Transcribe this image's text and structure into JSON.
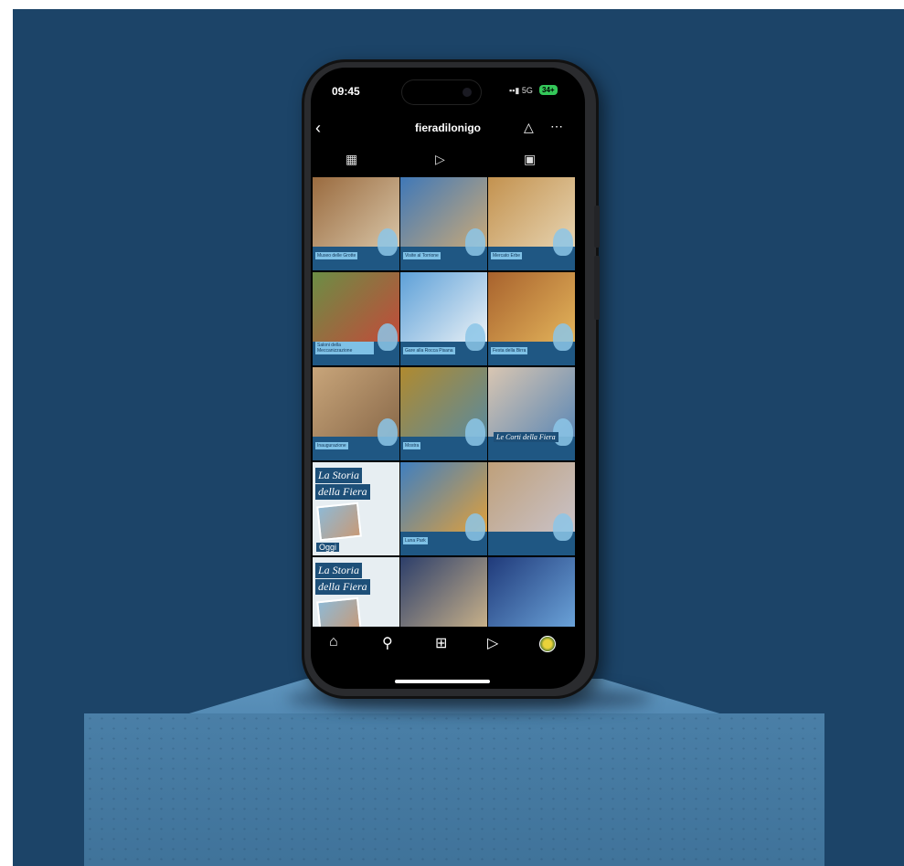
{
  "status": {
    "time": "09:45",
    "network": "5G",
    "battery": "34+"
  },
  "profile": {
    "username": "fieradilonigo"
  },
  "icons": {
    "back": "back-chevron-icon",
    "bell": "bell-icon",
    "more": "more-icon",
    "grid_tab": "grid-icon",
    "reels_tab": "reels-icon",
    "tagged_tab": "tagged-icon",
    "home": "home-icon",
    "search": "search-icon",
    "create": "create-icon",
    "reels": "reels-icon",
    "profile": "avatar"
  },
  "tiles": [
    {
      "label": "Museo delle Grotte",
      "colors": [
        "#9a6b3f",
        "#d7c4a6"
      ]
    },
    {
      "label": "Visite al Torrione",
      "colors": [
        "#3f78b8",
        "#c9a978"
      ]
    },
    {
      "label": "Mercato Erbe",
      "colors": [
        "#c3924f",
        "#e6d3b0"
      ]
    },
    {
      "label": "Saloni della Meccanizzazione",
      "colors": [
        "#6b8e45",
        "#c34a3a"
      ]
    },
    {
      "label": "Gare alla Rocca Pisana",
      "colors": [
        "#5da0d8",
        "#eaf1f6"
      ]
    },
    {
      "label": "Festa della Birra",
      "colors": [
        "#a8622d",
        "#e3b45b"
      ]
    },
    {
      "label": "Inaugurazione",
      "colors": [
        "#c8a57a",
        "#8a6a4a"
      ]
    },
    {
      "label": "Mostra",
      "colors": [
        "#b08a2f",
        "#5b8a9c"
      ]
    },
    {
      "label": "",
      "colors": [
        "#d9c6b2",
        "#5d88b4"
      ]
    },
    {
      "label": "",
      "colors": [
        "#e7eef2",
        "#1d4f78"
      ]
    },
    {
      "label": "Luna Park",
      "colors": [
        "#3f7fc0",
        "#e0a03c"
      ]
    },
    {
      "label": "",
      "colors": [
        "#bfa07a",
        "#c9c2c8"
      ]
    },
    {
      "label": "",
      "colors": [
        "#e7eef2",
        "#1d4f78"
      ]
    },
    {
      "label": "",
      "colors": [
        "#2c3e6a",
        "#c7b089"
      ]
    },
    {
      "label": "",
      "colors": [
        "#203a7a",
        "#6aa2d8"
      ]
    }
  ],
  "storia": {
    "line1": "La Storia",
    "line2_a": "della ",
    "line2_b": "Fiera",
    "oggi": "Oggi"
  },
  "corti": {
    "text": "Le Corti della Fiera"
  }
}
